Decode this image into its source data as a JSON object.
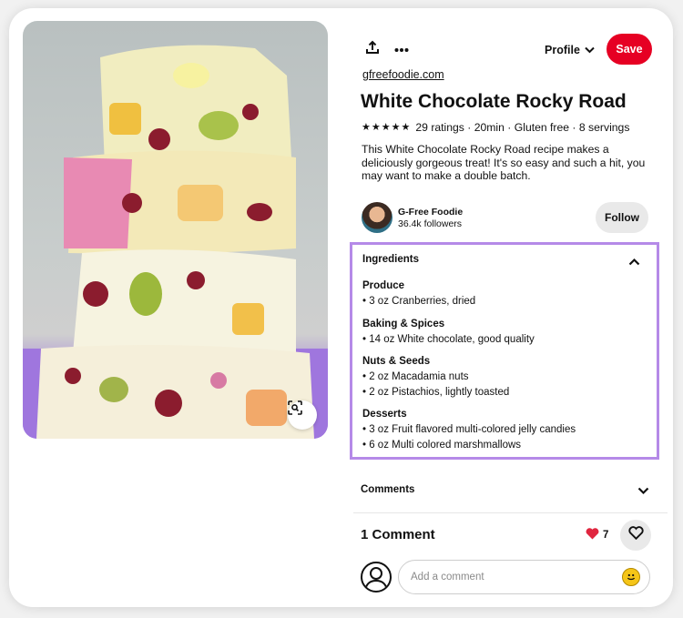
{
  "pin": {
    "source": "gfreefoodie.com",
    "title": "White Chocolate Rocky Road",
    "rating_stars": 5,
    "meta": "29 ratings · 20min · Gluten free · 8 servings",
    "description": "This White Chocolate Rocky Road recipe makes a deliciously gorgeous treat! It's so easy and such a hit, you may want to make a double batch."
  },
  "toolbar": {
    "share_icon": "share-icon",
    "more_icon": "more-icon",
    "profile_label": "Profile",
    "save_label": "Save",
    "save_color": "#e60023"
  },
  "author": {
    "name": "G-Free Foodie",
    "followers": "36.4k followers",
    "follow_label": "Follow"
  },
  "ingredients": {
    "heading": "Ingredients",
    "highlight_color": "#b58ae8",
    "groups": [
      {
        "title": "Produce",
        "items": [
          "• 3 oz Cranberries, dried"
        ]
      },
      {
        "title": "Baking & Spices",
        "items": [
          "• 14 oz White chocolate, good quality"
        ]
      },
      {
        "title": "Nuts & Seeds",
        "items": [
          "• 2 oz Macadamia nuts",
          "• 2 oz Pistachios, lightly toasted"
        ]
      },
      {
        "title": "Desserts",
        "items": [
          "• 3 oz Fruit flavored multi-colored jelly candies",
          "• 6 oz Multi colored marshmallows"
        ]
      }
    ]
  },
  "comments": {
    "section_label": "Comments",
    "count_label": "1 Comment",
    "reaction_count": "7",
    "input_placeholder": "Add a comment"
  }
}
